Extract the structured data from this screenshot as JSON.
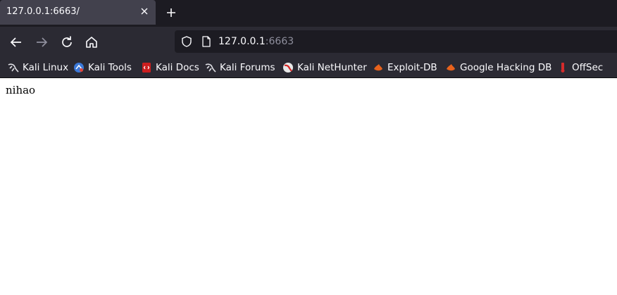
{
  "tab": {
    "title": "127.0.0.1:6663/",
    "close_icon": "close-icon",
    "new_tab_icon": "plus-icon"
  },
  "navbar": {
    "back_icon": "back-arrow-icon",
    "forward_icon": "forward-arrow-icon",
    "reload_icon": "reload-icon",
    "home_icon": "home-icon",
    "url": {
      "host": "127.0.0.1",
      "port": ":6663"
    }
  },
  "bookmarks": [
    {
      "label": "Kali Linux",
      "icon": "kali-dragon-icon"
    },
    {
      "label": "Kali Tools",
      "icon": "kali-tools-icon"
    },
    {
      "label": "Kali Docs",
      "icon": "kali-docs-icon"
    },
    {
      "label": "Kali Forums",
      "icon": "kali-dragon-icon"
    },
    {
      "label": "Kali NetHunter",
      "icon": "nethunter-icon"
    },
    {
      "label": "Exploit-DB",
      "icon": "exploit-db-icon"
    },
    {
      "label": "Google Hacking DB",
      "icon": "exploit-db-icon"
    },
    {
      "label": "OffSec",
      "icon": "offsec-icon"
    }
  ],
  "page": {
    "body_text": "nihao"
  },
  "colors": {
    "tabstrip_bg": "#1c1b22",
    "toolbar_bg": "#2b2a33",
    "active_tab_bg": "#42414d",
    "text_light": "#fbfbfe",
    "port_text": "#8f8f9d"
  }
}
